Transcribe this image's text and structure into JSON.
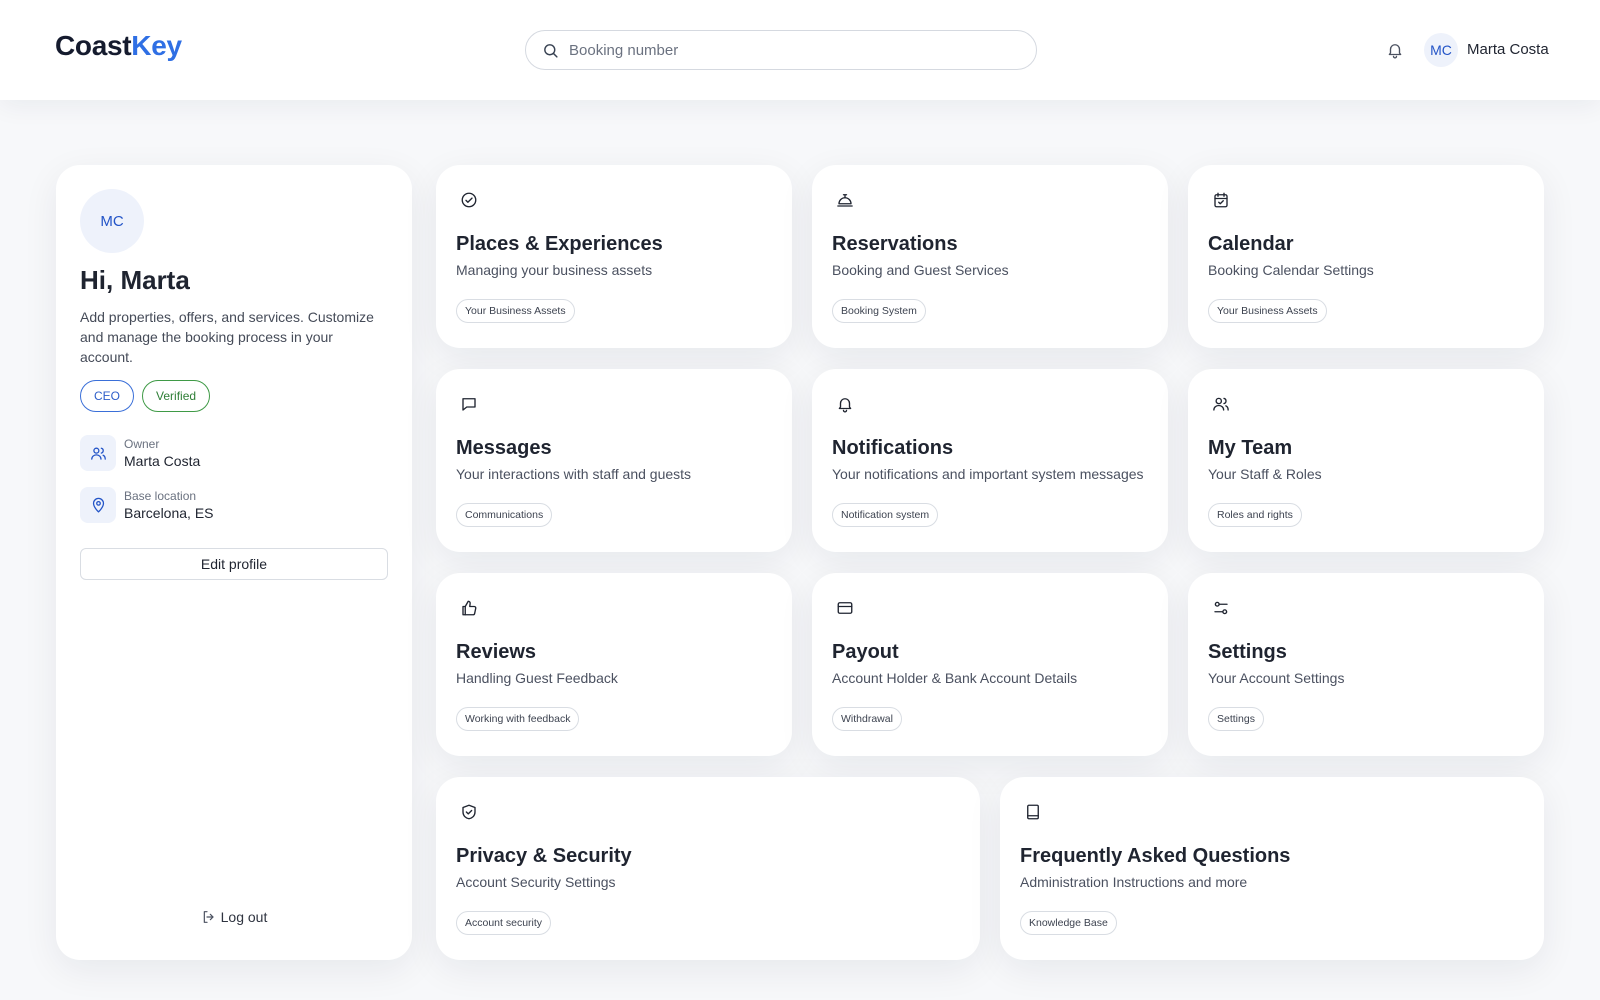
{
  "header": {
    "logo_part1": "Coast",
    "logo_part2": "Key",
    "search_placeholder": "Booking number",
    "user_initials": "MC",
    "user_name": "Marta Costa"
  },
  "profile": {
    "initials": "MC",
    "greeting": "Hi, Marta",
    "description": "Add properties, offers, and services. Customize and manage the booking process in your account.",
    "badges": [
      "CEO",
      "Verified"
    ],
    "owner_label": "Owner",
    "owner_value": "Marta Costa",
    "location_label": "Base location",
    "location_value": "Barcelona, ES",
    "edit_label": "Edit profile",
    "logout_label": "Log out"
  },
  "cards": [
    {
      "icon": "check-circle-icon",
      "title": "Places & Experiences",
      "subtitle": "Managing your business assets",
      "tag": "Your Business Assets"
    },
    {
      "icon": "concierge-bell-icon",
      "title": "Reservations",
      "subtitle": "Booking and Guest Services",
      "tag": "Booking System"
    },
    {
      "icon": "calendar-check-icon",
      "title": "Calendar",
      "subtitle": "Booking Calendar Settings",
      "tag": "Your Business Assets"
    },
    {
      "icon": "message-square-icon",
      "title": "Messages",
      "subtitle": "Your interactions with staff and guests",
      "tag": "Communications"
    },
    {
      "icon": "bell-icon",
      "title": "Notifications",
      "subtitle": "Your notifications and important system messages",
      "tag": "Notification system"
    },
    {
      "icon": "users-icon",
      "title": "My Team",
      "subtitle": "Your Staff & Roles",
      "tag": "Roles and rights"
    },
    {
      "icon": "thumbs-up-icon",
      "title": "Reviews",
      "subtitle": "Handling Guest Feedback",
      "tag": "Working with feedback"
    },
    {
      "icon": "credit-card-icon",
      "title": "Payout",
      "subtitle": "Account Holder & Bank Account Details",
      "tag": "Withdrawal"
    },
    {
      "icon": "sliders-icon",
      "title": "Settings",
      "subtitle": "Your Account Settings",
      "tag": "Settings"
    },
    {
      "icon": "shield-check-icon",
      "title": "Privacy & Security",
      "subtitle": "Account Security Settings",
      "tag": "Account security"
    },
    {
      "icon": "book-icon",
      "title": "Frequently Asked Questions",
      "subtitle": "Administration Instructions and more",
      "tag": "Knowledge Base"
    }
  ],
  "colors": {
    "accent": "#2f6fe4",
    "verified": "#2f7f36",
    "background": "#f7f8fa"
  }
}
